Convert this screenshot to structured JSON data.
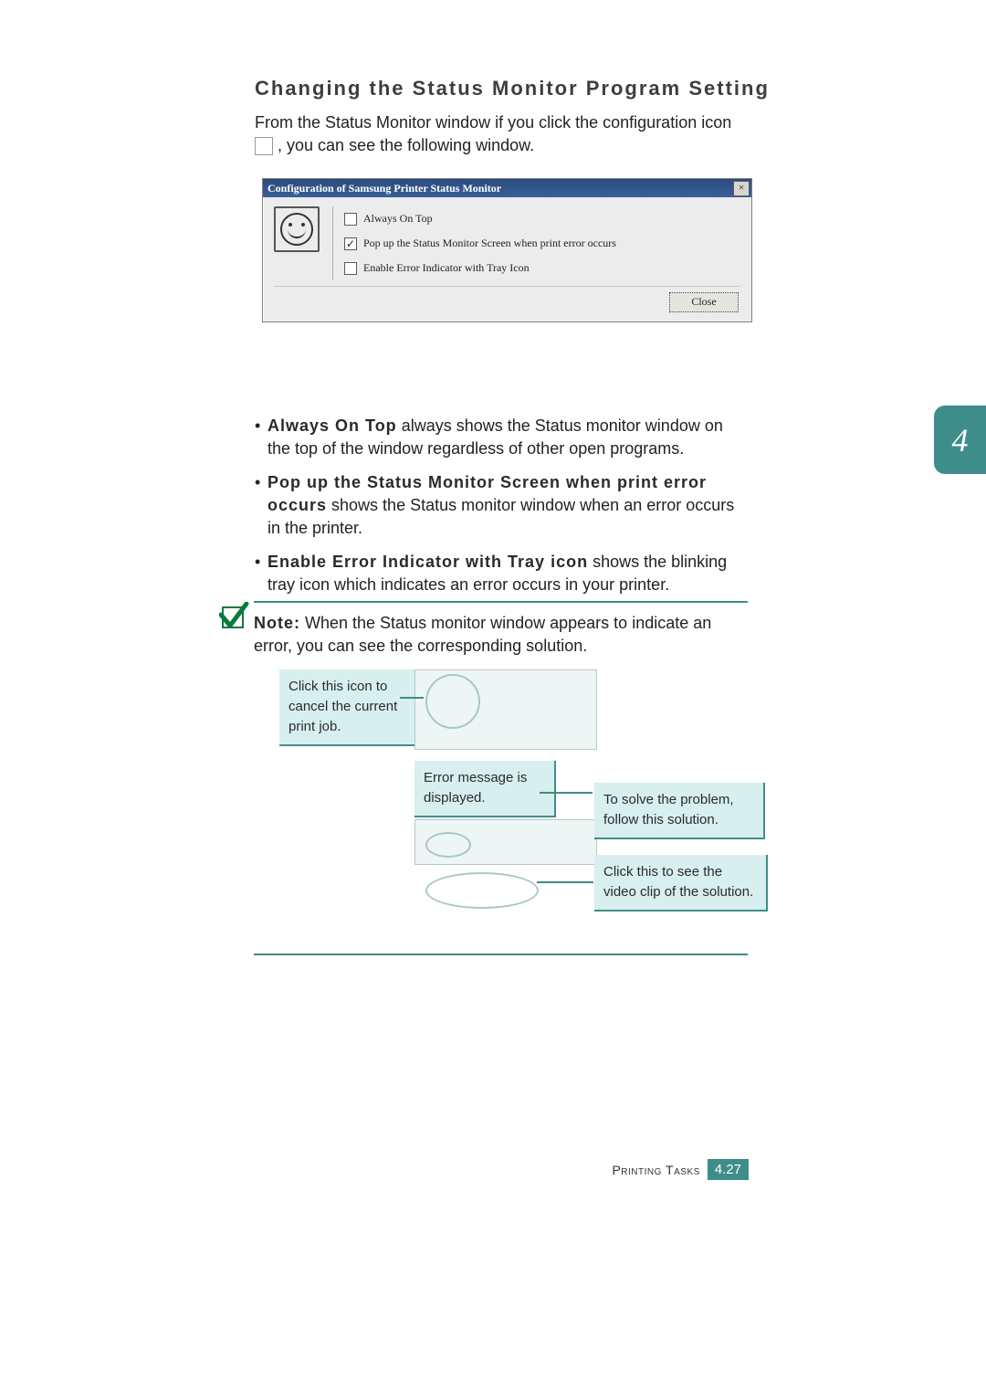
{
  "title": "Changing the Status Monitor Program Setting",
  "intro_before": "From the Status Monitor window if you click the configuration icon ",
  "intro_after": " , you can see the following window.",
  "dialog": {
    "title": "Configuration of Samsung Printer Status Monitor",
    "close": "×",
    "options": [
      {
        "label": "Always On Top",
        "checked": false
      },
      {
        "label": "Pop up the Status Monitor Screen when print error occurs",
        "checked": true
      },
      {
        "label": "Enable Error Indicator with Tray Icon",
        "checked": false
      }
    ],
    "button": "Close"
  },
  "bullets": [
    {
      "term": "Always On Top",
      "text": " always shows the Status monitor window on the top of the window regardless of other open programs."
    },
    {
      "term": "Pop up the Status Monitor Screen when print error occurs",
      "text": " shows the Status monitor window when an error occurs in the printer."
    },
    {
      "term": "Enable Error Indicator with Tray icon",
      "text": " shows the blinking tray icon which indicates an error occurs in your printer."
    }
  ],
  "note_label": "Note:",
  "note_text": " When the Status monitor window appears to indicate an error, you can see the corresponding solution.",
  "callouts": {
    "c1": "Click this icon to cancel the current print job.",
    "c2": "Error message is displayed.",
    "c3": "To solve the problem, follow this solution.",
    "c4": "Click this to see the video clip of the solution."
  },
  "sidetab": "4",
  "footer_section": "Printing Tasks",
  "footer_page": "4.27"
}
